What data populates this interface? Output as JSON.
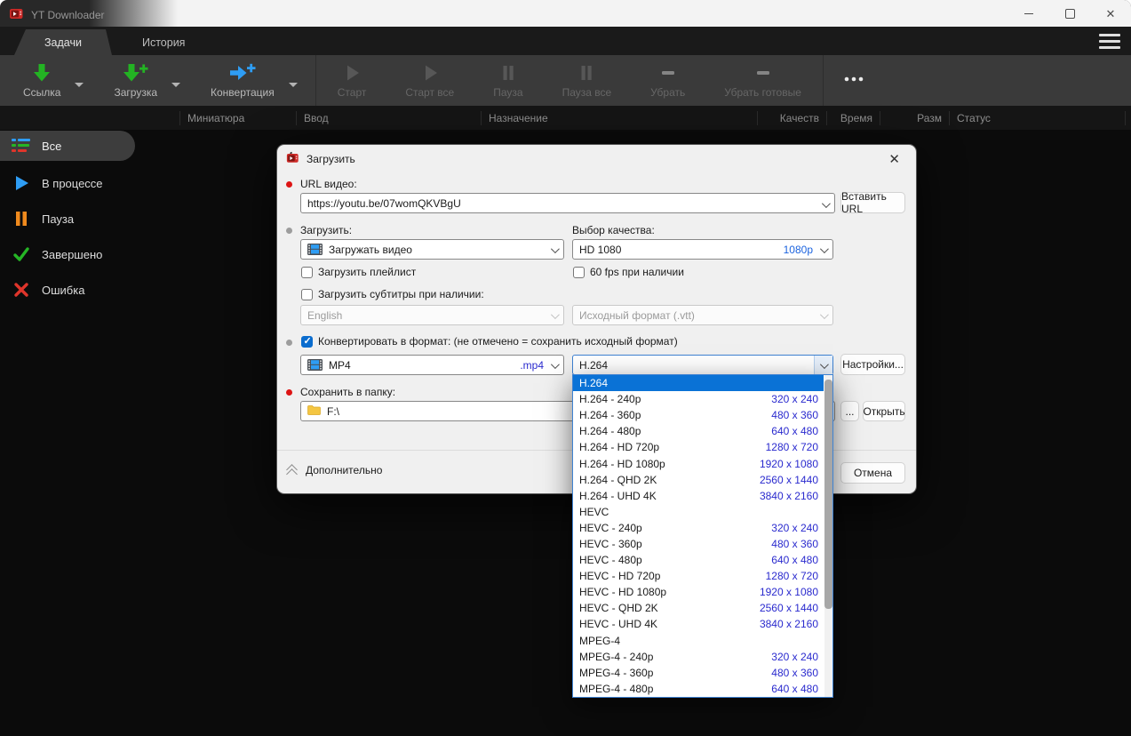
{
  "window": {
    "title": "YT Downloader"
  },
  "tabs": [
    {
      "name": "tasks",
      "label": "Задачи",
      "active": true
    },
    {
      "name": "history",
      "label": "История",
      "active": false
    }
  ],
  "toolbar": [
    {
      "name": "link",
      "label": "Ссылка",
      "icon": "green-down-arrow",
      "enabled": true,
      "has_caret": true
    },
    {
      "name": "download",
      "label": "Загрузка",
      "icon": "green-down-arrow-plus",
      "enabled": true,
      "has_caret": true
    },
    {
      "name": "convert",
      "label": "Конвертация",
      "icon": "blue-right-arrow-plus",
      "enabled": true,
      "has_caret": true
    },
    {
      "name": "start",
      "label": "Старт",
      "icon": "play",
      "enabled": false,
      "sep_before": true
    },
    {
      "name": "start-all",
      "label": "Старт все",
      "icon": "play",
      "enabled": false
    },
    {
      "name": "pause",
      "label": "Пауза",
      "icon": "pause",
      "enabled": false
    },
    {
      "name": "pause-all",
      "label": "Пауза все",
      "icon": "pause",
      "enabled": false
    },
    {
      "name": "remove",
      "label": "Убрать",
      "icon": "minus",
      "enabled": false
    },
    {
      "name": "remove-completed",
      "label": "Убрать готовые",
      "icon": "minus",
      "enabled": false
    },
    {
      "name": "more",
      "label": "",
      "icon": "dots",
      "enabled": true,
      "sep_before": true
    }
  ],
  "columns": [
    "Миниатюра",
    "Ввод",
    "Назначение",
    "Качеств",
    "Время",
    "Разм",
    "Статус"
  ],
  "sidebar": [
    {
      "name": "all",
      "label": "Все",
      "icon": "list",
      "active": true
    },
    {
      "name": "in-progress",
      "label": "В процессе",
      "icon": "play-blue",
      "active": false
    },
    {
      "name": "paused",
      "label": "Пауза",
      "icon": "pause-orange",
      "active": false
    },
    {
      "name": "completed",
      "label": "Завершено",
      "icon": "check-green",
      "active": false
    },
    {
      "name": "error",
      "label": "Ошибка",
      "icon": "cross-red",
      "active": false
    }
  ],
  "dialog": {
    "title": "Загрузить",
    "url_label": "URL видео:",
    "url_value": "https://youtu.be/07womQKVBgU",
    "paste_button": "Вставить URL",
    "download_label": "Загрузить:",
    "download_value": "Загружать видео",
    "quality_label": "Выбор качества:",
    "quality_value": "HD 1080",
    "quality_badge": "1080p",
    "playlist_checkbox": "Загрузить плейлист",
    "fps_checkbox": "60 fps при наличии",
    "subtitles_checkbox": "Загрузить субтитры при наличии:",
    "subtitles_lang": "English",
    "subtitles_format": "Исходный формат (.vtt)",
    "convert_checkbox": "Конвертировать в формат: (не отмечено = сохранить исходный формат)",
    "convert_checked": true,
    "container_value": "MP4",
    "container_ext": ".mp4",
    "codec_value": "H.264",
    "settings_button": "Настройки...",
    "folder_label": "Сохранить в папку:",
    "folder_value": "F:\\",
    "browse_button": "...",
    "open_button": "Открыть",
    "advanced_label": "Дополнительно",
    "cancel_button": "Отмена"
  },
  "codec_list": [
    {
      "name": "H.264",
      "res": "",
      "selected": true
    },
    {
      "name": "H.264 - 240p",
      "res": "320 x 240"
    },
    {
      "name": "H.264 - 360p",
      "res": "480 x 360"
    },
    {
      "name": "H.264 - 480p",
      "res": "640 x 480"
    },
    {
      "name": "H.264 - HD 720p",
      "res": "1280 x 720"
    },
    {
      "name": "H.264 - HD 1080p",
      "res": "1920 x 1080"
    },
    {
      "name": "H.264 - QHD 2K",
      "res": "2560 x 1440"
    },
    {
      "name": "H.264 - UHD 4K",
      "res": "3840 x 2160"
    },
    {
      "name": "HEVC",
      "res": ""
    },
    {
      "name": "HEVC - 240p",
      "res": "320 x 240"
    },
    {
      "name": "HEVC - 360p",
      "res": "480 x 360"
    },
    {
      "name": "HEVC - 480p",
      "res": "640 x 480"
    },
    {
      "name": "HEVC - HD 720p",
      "res": "1280 x 720"
    },
    {
      "name": "HEVC - HD 1080p",
      "res": "1920 x 1080"
    },
    {
      "name": "HEVC - QHD 2K",
      "res": "2560 x 1440"
    },
    {
      "name": "HEVC - UHD 4K",
      "res": "3840 x 2160"
    },
    {
      "name": "MPEG-4",
      "res": ""
    },
    {
      "name": "MPEG-4 - 240p",
      "res": "320 x 240"
    },
    {
      "name": "MPEG-4 - 360p",
      "res": "480 x 360"
    },
    {
      "name": "MPEG-4 - 480p",
      "res": "640 x 480"
    }
  ],
  "colors": {
    "selection_blue": "#0a72d6",
    "resolution_blue": "#2a2ace",
    "quality_blue": "#1b63df",
    "accent_green": "#23b323",
    "accent_blue": "#2e9df4",
    "accent_orange": "#f08a1d",
    "accent_red": "#df352b"
  }
}
